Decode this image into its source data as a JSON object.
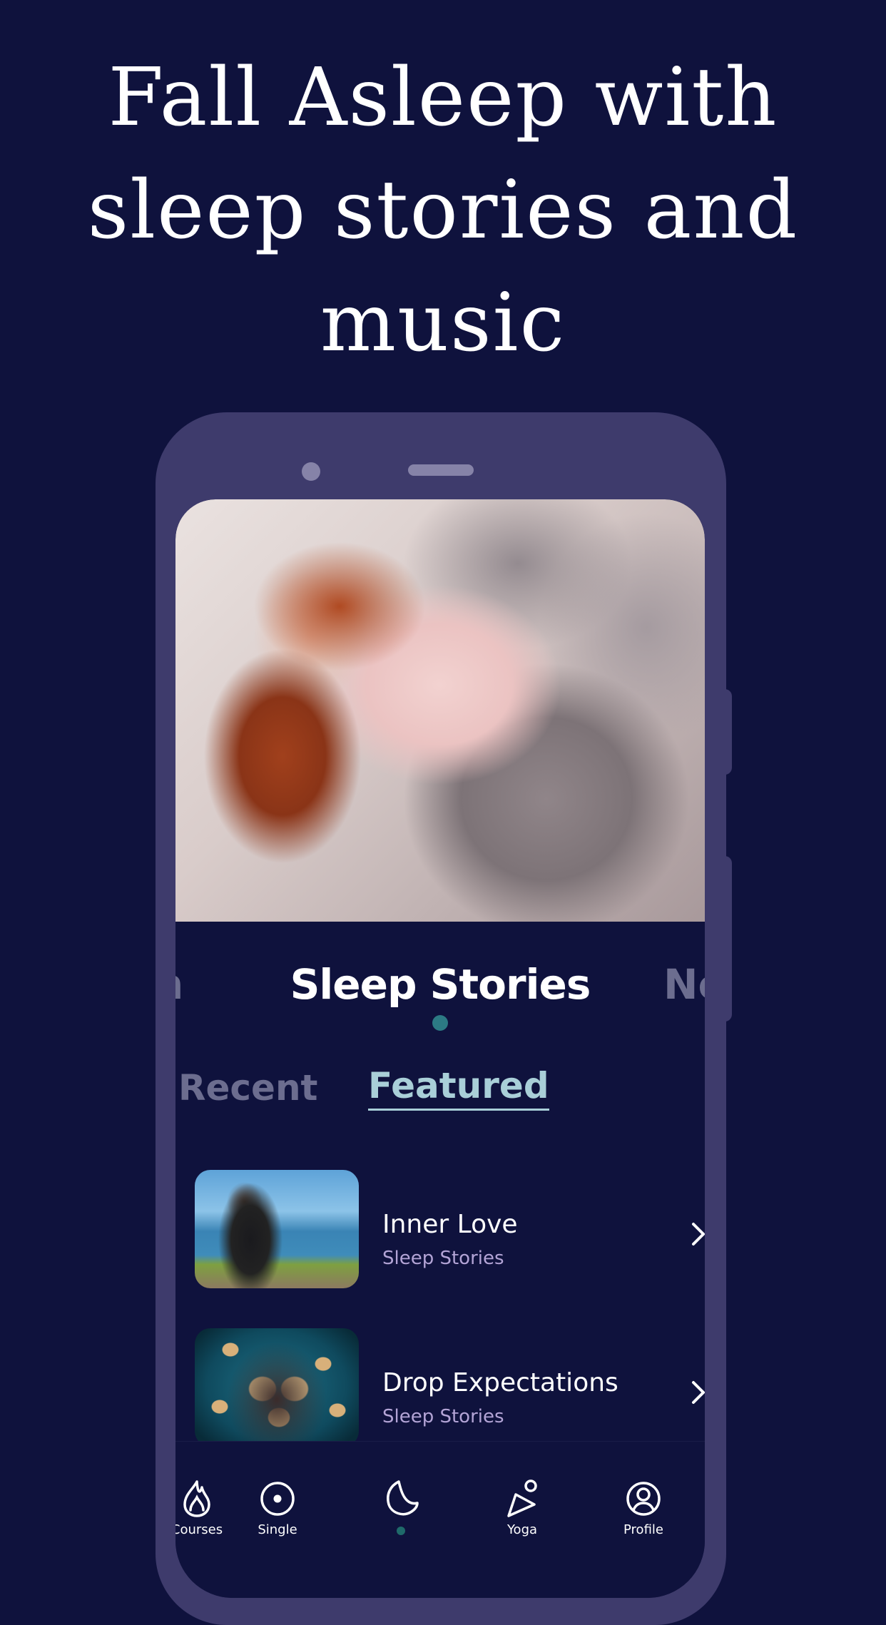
{
  "headline": {
    "line1": "Fall Asleep with",
    "line2": "sleep stories and",
    "line3": "music"
  },
  "colors": {
    "background": "#0f123d",
    "phone_frame": "#3e3b6c",
    "accent_teal": "#2c7a84",
    "featured_tab": "#a9cfd8",
    "subtitle_purple": "#b3a4d6",
    "inactive_text": "#6c6d8f"
  },
  "hero_image": {
    "description": "Red-haired woman in pink pajamas sleeping in bed with grey sheets"
  },
  "categories": {
    "prev_partial": "n",
    "active": "Sleep Stories",
    "next_partial": "Ne"
  },
  "subtabs": {
    "recent": "Recent",
    "featured": "Featured",
    "selected": "Featured"
  },
  "items": [
    {
      "title": "Inner Love",
      "subtitle": "Sleep Stories",
      "thumbnail": "Man sitting by the sea with eyes closed",
      "chevron": "chevron-right-icon"
    },
    {
      "title": "Drop Expectations",
      "subtitle": "Sleep Stories",
      "thumbnail": "Man covered in sticky notes",
      "chevron": "chevron-right-icon"
    }
  ],
  "bottom_nav": [
    {
      "label": "Courses",
      "icon": "flame-icon"
    },
    {
      "label": "Single",
      "icon": "target-circle-icon"
    },
    {
      "label": "",
      "icon": "moon-icon",
      "active": true
    },
    {
      "label": "Yoga",
      "icon": "yoga-pose-icon"
    },
    {
      "label": "Profile",
      "icon": "profile-icon"
    }
  ]
}
